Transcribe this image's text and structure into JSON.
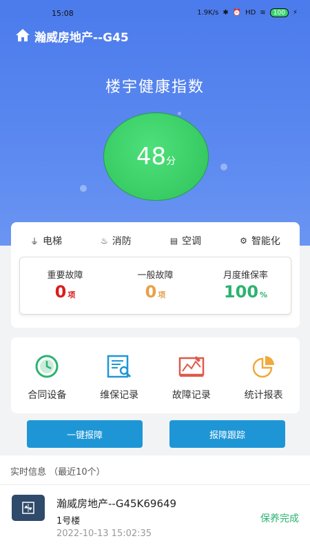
{
  "status_bar": {
    "time": "15:08",
    "net_speed": "1.9K/s",
    "signal": "HD",
    "battery": "100"
  },
  "header": {
    "title": "瀚威房地产--G45"
  },
  "health": {
    "title": "楼宇健康指数",
    "score": "48",
    "unit": "分"
  },
  "tabs": [
    {
      "label": "电梯",
      "icon": "elevator-icon"
    },
    {
      "label": "消防",
      "icon": "fire-extinguisher-icon"
    },
    {
      "label": "空调",
      "icon": "air-conditioner-icon"
    },
    {
      "label": "智能化",
      "icon": "gear-icon"
    }
  ],
  "stats": [
    {
      "label": "重要故障",
      "value": "0",
      "unit": "项",
      "color": "#d81e1e"
    },
    {
      "label": "一般故障",
      "value": "0",
      "unit": "项",
      "color": "#e8a04a"
    },
    {
      "label": "月度维保率",
      "value": "100",
      "unit": "%",
      "color": "#2bb36f"
    }
  ],
  "functions": [
    {
      "label": "合同设备",
      "icon": "clock-icon",
      "color": "#2bb36f"
    },
    {
      "label": "维保记录",
      "icon": "maintenance-record-icon",
      "color": "#1e96d6"
    },
    {
      "label": "故障记录",
      "icon": "fault-chart-icon",
      "color": "#e0584a"
    },
    {
      "label": "统计报表",
      "icon": "pie-chart-icon",
      "color": "#f0a93c"
    }
  ],
  "buttons": {
    "report": "一键报障",
    "track": "报障跟踪"
  },
  "realtime": {
    "heading": "实时信息 （最近10个）",
    "items": [
      {
        "title": "瀚威房地产--G45K69649",
        "location": "1号楼",
        "time": "2022-10-13 15:02:35",
        "status": "保养完成"
      }
    ]
  }
}
